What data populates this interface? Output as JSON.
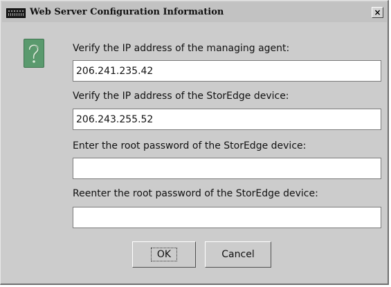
{
  "window": {
    "title": "Web Server Configuration Information",
    "close_label": "×"
  },
  "icons": {
    "dialog_icon": "question-icon",
    "app_icon": "window-app-icon"
  },
  "form": {
    "managing_agent_ip": {
      "label": "Verify the IP address of the managing agent:",
      "value": "206.241.235.42"
    },
    "storedge_ip": {
      "label": "Verify the IP address of the StorEdge device:",
      "value": "206.243.255.52"
    },
    "root_password": {
      "label": "Enter the root password of the StorEdge device:",
      "value": ""
    },
    "root_password_confirm": {
      "label": "Reenter the root password of the StorEdge device:",
      "value": ""
    }
  },
  "buttons": {
    "ok_label": "OK",
    "cancel_label": "Cancel"
  },
  "colors": {
    "dialog_background": "#cccccc",
    "question_icon": "#5a9a6e"
  }
}
